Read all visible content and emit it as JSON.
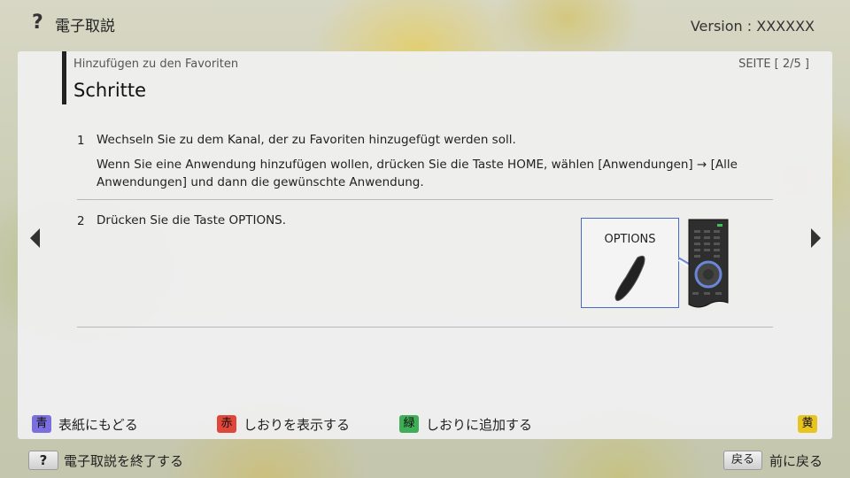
{
  "header": {
    "help_icon": "question-mark-icon",
    "app_title": "電子取説",
    "version": "Version : XXXXXX"
  },
  "panel": {
    "breadcrumb": "Hinzufügen zu den Favoriten",
    "page_counter": "SEITE [ 2/5 ]",
    "title": "Schritte"
  },
  "steps": [
    {
      "num": "1",
      "text": "Wechseln Sie zu dem Kanal, der zu Favoriten hinzugefügt werden soll.",
      "note": "Wenn Sie eine Anwendung hinzufügen wollen, drücken Sie die Taste HOME, wählen [Anwendungen] → [Alle Anwendungen] und dann die gewünschte Anwendung."
    },
    {
      "num": "2",
      "text": "Drücken Sie die Taste OPTIONS.",
      "illustration_label": "OPTIONS"
    }
  ],
  "navigation": {
    "prev_icon": "triangle-left-icon",
    "next_icon": "triangle-right-icon"
  },
  "footer_legend": {
    "blue": {
      "key": "青",
      "label": "表紙にもどる",
      "color": "#7b6fe0"
    },
    "red": {
      "key": "赤",
      "label": "しおりを表示する",
      "color": "#e0473a"
    },
    "green": {
      "key": "緑",
      "label": "しおりに追加する",
      "color": "#3fae56"
    },
    "yellow": {
      "key": "黄",
      "label": "",
      "color": "#e8c51e"
    }
  },
  "bottom_bar": {
    "help_key": "?",
    "exit_label": "電子取説を終了する",
    "back_key": "戻る",
    "back_label": "前に戻る"
  }
}
